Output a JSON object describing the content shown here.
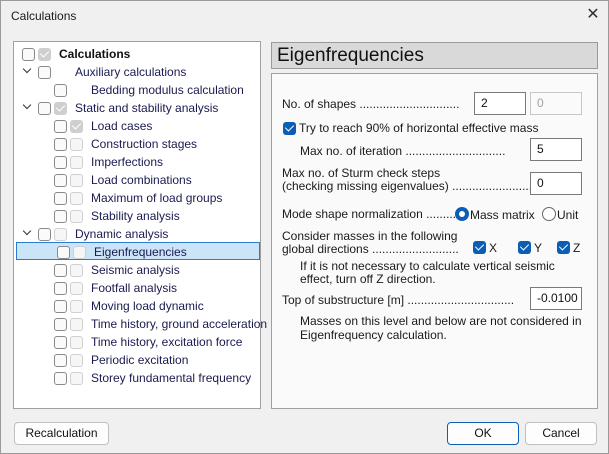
{
  "window": {
    "title": "Calculations",
    "close_icon": "close-icon"
  },
  "tree": [
    {
      "label": "Calculations",
      "chevron": false,
      "cb1": "empty",
      "cb2": "gray-checked",
      "bold": true,
      "indent": 0
    },
    {
      "label": "Auxiliary calculations",
      "chevron": true,
      "cb1": "empty",
      "cb2": null,
      "indent": 1
    },
    {
      "label": "Bedding modulus calculation",
      "chevron": false,
      "cb1": "empty",
      "cb2": null,
      "indent": 2
    },
    {
      "label": "Static and stability analysis",
      "chevron": true,
      "cb1": "empty",
      "cb2": "gray-checked",
      "indent": 1
    },
    {
      "label": "Load cases",
      "chevron": false,
      "cb1": "empty",
      "cb2": "gray-checked",
      "indent": 2
    },
    {
      "label": "Construction stages",
      "chevron": false,
      "cb1": "empty",
      "cb2": "gray",
      "indent": 2
    },
    {
      "label": "Imperfections",
      "chevron": false,
      "cb1": "empty",
      "cb2": "gray",
      "indent": 2
    },
    {
      "label": "Load combinations",
      "chevron": false,
      "cb1": "empty",
      "cb2": "gray",
      "indent": 2
    },
    {
      "label": "Maximum of load groups",
      "chevron": false,
      "cb1": "empty",
      "cb2": "gray",
      "indent": 2
    },
    {
      "label": "Stability analysis",
      "chevron": false,
      "cb1": "empty",
      "cb2": "gray",
      "indent": 2
    },
    {
      "label": "Dynamic analysis",
      "chevron": true,
      "cb1": "empty",
      "cb2": "gray",
      "indent": 1
    },
    {
      "label": "Eigenfrequencies",
      "chevron": false,
      "cb1": "empty",
      "cb2": "gray",
      "indent": 2,
      "selected": true
    },
    {
      "label": "Seismic analysis",
      "chevron": false,
      "cb1": "empty",
      "cb2": "gray",
      "indent": 2
    },
    {
      "label": "Footfall analysis",
      "chevron": false,
      "cb1": "empty",
      "cb2": "gray",
      "indent": 2
    },
    {
      "label": "Moving load dynamic",
      "chevron": false,
      "cb1": "empty",
      "cb2": "gray",
      "indent": 2
    },
    {
      "label": "Time history, ground acceleration",
      "chevron": false,
      "cb1": "empty",
      "cb2": "gray",
      "indent": 2
    },
    {
      "label": "Time history, excitation force",
      "chevron": false,
      "cb1": "empty",
      "cb2": "gray",
      "indent": 2
    },
    {
      "label": "Periodic excitation",
      "chevron": false,
      "cb1": "empty",
      "cb2": "gray",
      "indent": 2
    },
    {
      "label": "Storey fundamental frequency",
      "chevron": false,
      "cb1": "empty",
      "cb2": "gray",
      "indent": 2
    }
  ],
  "panel": {
    "title": "Eigenfrequencies",
    "no_shapes_label": "No. of shapes ..............................",
    "no_shapes_value": "2",
    "no_shapes_result": "0",
    "try90_label": "Try to reach 90% of horizontal effective mass",
    "try90_checked": true,
    "max_iter_label": "Max no. of iteration ..............................",
    "max_iter_value": "5",
    "sturm_label1": "Max no. of Sturm check steps",
    "sturm_label2": "(checking missing eigenvalues) ........................",
    "sturm_value": "0",
    "norm_label": "Mode shape normalization .........",
    "norm_options": [
      "Mass matrix",
      "Unit"
    ],
    "norm_selected": "Mass matrix",
    "masses_label1": "Consider masses in the following",
    "masses_label2": "global directions ..........................",
    "directions": [
      {
        "label": "X",
        "checked": true
      },
      {
        "label": "Y",
        "checked": true
      },
      {
        "label": "Z",
        "checked": true
      }
    ],
    "masses_note1": "If it is not necessary to calculate vertical seismic",
    "masses_note2": "effect, turn off Z direction.",
    "substructure_label": "Top of substructure [m] ................................",
    "substructure_value": "-0.0100",
    "substructure_note1": "Masses on this level and below are not considered in",
    "substructure_note2": "Eigenfrequency calculation."
  },
  "buttons": {
    "recalc": "Recalculation",
    "ok": "OK",
    "cancel": "Cancel"
  },
  "colors": {
    "accent": "#0a5fb4",
    "selection": "#cce4f7"
  }
}
